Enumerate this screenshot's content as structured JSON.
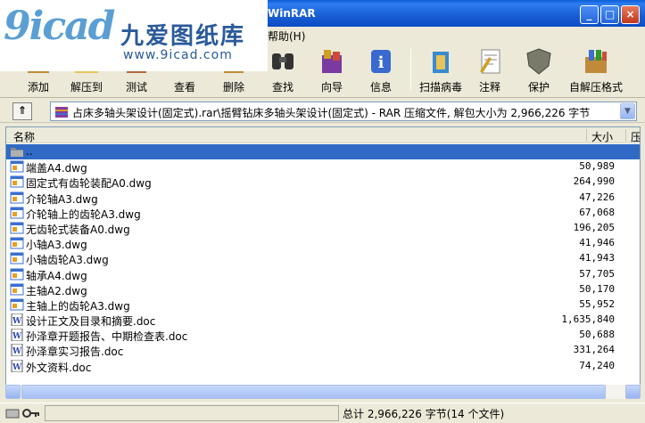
{
  "window": {
    "title": "WinRAR",
    "watermark": {
      "logo": "9icad",
      "cn": "九爱图纸库",
      "url": "www.9icad.com"
    }
  },
  "menu": {
    "visible_item": "帮助(H)"
  },
  "toolbar": {
    "items": [
      {
        "label": "添加",
        "icon": "add-archive-icon"
      },
      {
        "label": "解压到",
        "icon": "extract-to-icon"
      },
      {
        "label": "测试",
        "icon": "test-icon"
      },
      {
        "label": "查看",
        "icon": "view-icon"
      },
      {
        "label": "删除",
        "icon": "delete-icon"
      },
      {
        "label": "查找",
        "icon": "find-icon"
      },
      {
        "label": "向导",
        "icon": "wizard-icon"
      },
      {
        "label": "信息",
        "icon": "info-icon"
      },
      {
        "label": "扫描病毒",
        "icon": "virus-scan-icon"
      },
      {
        "label": "注释",
        "icon": "comment-icon"
      },
      {
        "label": "保护",
        "icon": "protect-icon"
      },
      {
        "label": "自解压格式",
        "icon": "sfx-icon"
      }
    ]
  },
  "address": {
    "path": "占床多轴头架设计(固定式).rar\\摇臂钻床多轴头架设计(固定式) - RAR 压缩文件, 解包大小为 2,966,226 字节"
  },
  "columns": {
    "name": "名称",
    "size": "大小",
    "packed": "压"
  },
  "files": [
    {
      "name": "..",
      "size": "",
      "type": "folder",
      "selected": true
    },
    {
      "name": "端盖A4.dwg",
      "size": "50,989",
      "type": "dwg"
    },
    {
      "name": "固定式有齿轮装配A0.dwg",
      "size": "264,990",
      "type": "dwg"
    },
    {
      "name": "介轮轴A3.dwg",
      "size": "47,226",
      "type": "dwg"
    },
    {
      "name": "介轮轴上的齿轮A3.dwg",
      "size": "67,068",
      "type": "dwg"
    },
    {
      "name": "无齿轮式装备A0.dwg",
      "size": "196,205",
      "type": "dwg"
    },
    {
      "name": "小轴A3.dwg",
      "size": "41,946",
      "type": "dwg"
    },
    {
      "name": "小轴齿轮A3.dwg",
      "size": "41,943",
      "type": "dwg"
    },
    {
      "name": "轴承A4.dwg",
      "size": "57,705",
      "type": "dwg"
    },
    {
      "name": "主轴A2.dwg",
      "size": "50,170",
      "type": "dwg"
    },
    {
      "name": "主轴上的齿轮A3.dwg",
      "size": "55,952",
      "type": "dwg"
    },
    {
      "name": "设计正文及目录和摘要.doc",
      "size": "1,635,840",
      "type": "doc"
    },
    {
      "name": "孙泽章开题报告、中期检查表.doc",
      "size": "50,688",
      "type": "doc"
    },
    {
      "name": "孙泽章实习报告.doc",
      "size": "331,264",
      "type": "doc"
    },
    {
      "name": "外文资料.doc",
      "size": "74,240",
      "type": "doc"
    }
  ],
  "status": {
    "text": "总计 2,966,226 字节(14 个文件)"
  },
  "colors": {
    "title": "#1a5fd6",
    "selection": "#316ac5",
    "background": "#ece9d8"
  }
}
